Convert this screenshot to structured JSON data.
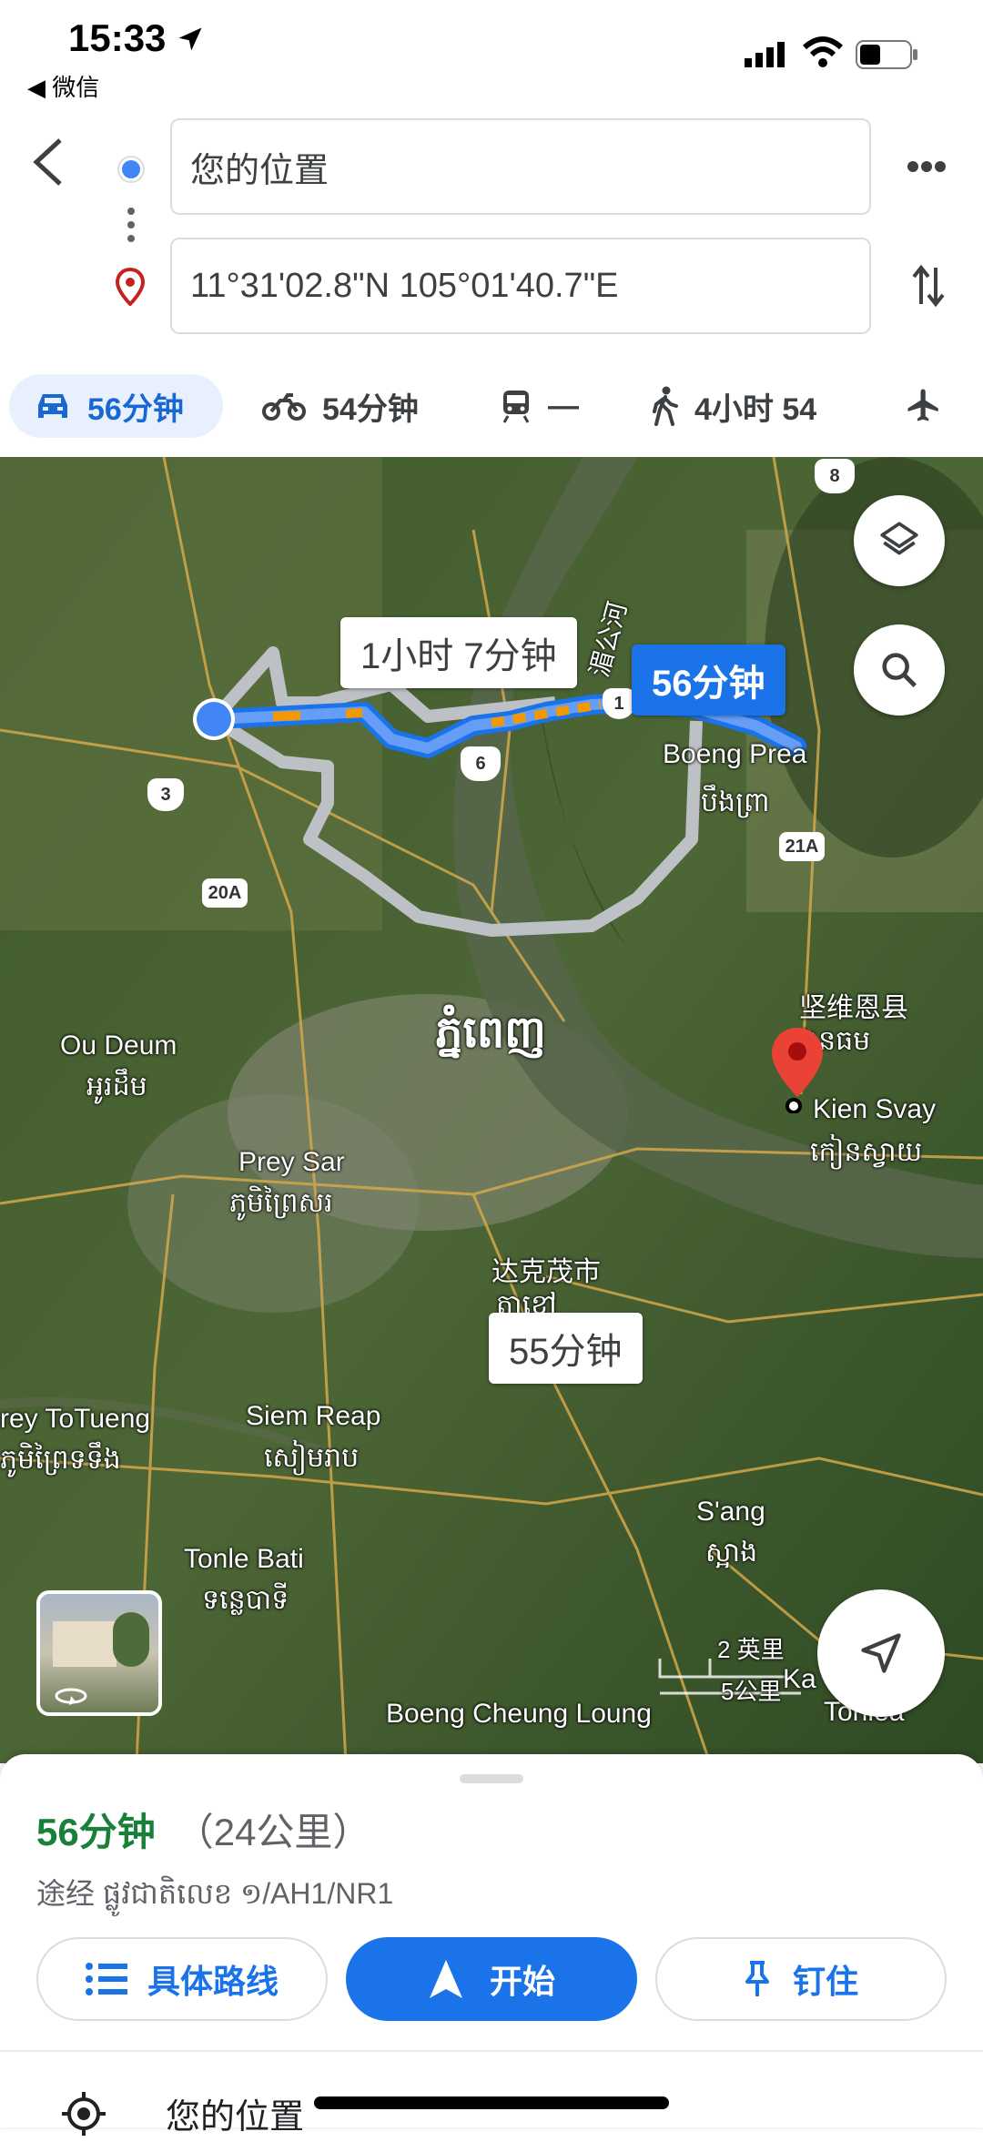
{
  "status": {
    "time": "15:33",
    "back_app": "◀ 微信"
  },
  "route": {
    "origin": "您的位置",
    "destination": "11°31'02.8\"N 105°01'40.7\"E"
  },
  "modes": [
    {
      "name": "drive",
      "label": "56分钟"
    },
    {
      "name": "motorbike",
      "label": "54分钟"
    },
    {
      "name": "transit",
      "label": "—"
    },
    {
      "name": "walk",
      "label": "4小时 54"
    }
  ],
  "map": {
    "labels": {
      "river": "湄公河",
      "boeng_prea": "Boeng Prea",
      "boeng_prea_kh": "បឹងព្រា",
      "ou_deum": "Ou Deum",
      "ou_deum_kh": "អូរដឹម",
      "phnom_penh_kh": "ភ្នំពេញ",
      "prey_sar": "Prey Sar",
      "prey_sar_kh": "ភូមិព្រៃសរ",
      "dakemao": "达克茂市",
      "dakemao_kh": "តាខ្មៅ",
      "prey_totueng": "rey ToTueng",
      "prey_totueng_kh": "ភូមិព្រៃទទឹង",
      "siem_reap": "Siem Reap",
      "siem_reap_kh": "សៀមរាប",
      "tonle_bati": "Tonle Bati",
      "tonle_bati_kh": "ទន្លេបាទី",
      "sang": "S'ang",
      "sang_kh": "ស្អាង",
      "boeng_cheung_loung": "Boeng Cheung Loung",
      "kien_svay": "Kien Svay",
      "kien_svay_kh": "កៀនស្វាយ",
      "kien_svay_cn": "坚维恩县",
      "kien_svay_cn_kh": "ងនធម",
      "kaoh": "Ka",
      "tonlea": "Tonlea"
    },
    "route_times": {
      "alt1": "1小时 7分钟",
      "selected": "56分钟",
      "alt2": "55分钟"
    },
    "shields": [
      "8",
      "6",
      "1",
      "3",
      "20A",
      "21A"
    ],
    "scale": {
      "miles": "2 英里",
      "km": "5公里"
    }
  },
  "summary": {
    "duration": "56分钟",
    "distance": "（24公里）",
    "via": "途经 ផ្លូវជាតិលេខ ១/AH1/NR1"
  },
  "actions": {
    "steps": "具体路线",
    "start": "开始",
    "pin": "钉住"
  },
  "list": {
    "first_item": "您的位置"
  },
  "colors": {
    "accent": "#1a73e8",
    "duration_green": "#188038"
  }
}
